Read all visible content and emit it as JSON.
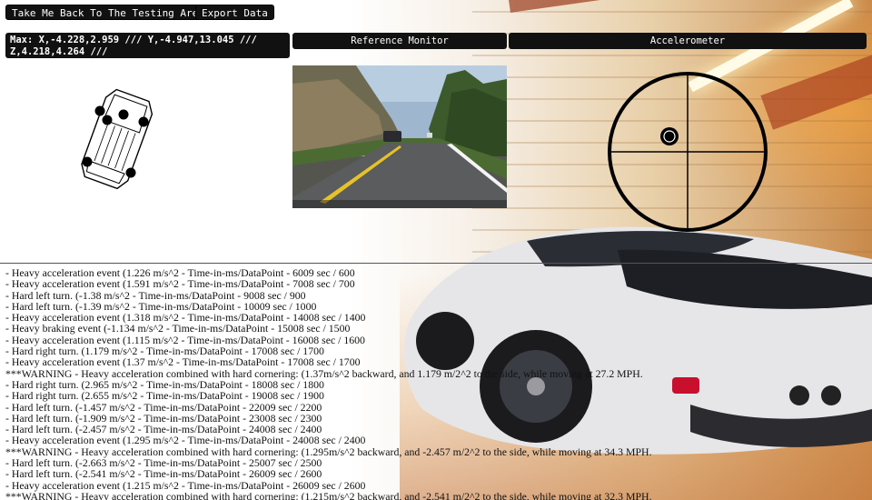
{
  "toolbar": {
    "back_label": "Take Me Back To The Testing Area",
    "export_label": "Export Data"
  },
  "max_readout": "Max: X,-4.228,2.959 /// Y,-4.947,13.045 /// Z,4.218,4.264 ///",
  "panels": {
    "reference_monitor": "Reference Monitor",
    "accelerometer": "Accelerometer"
  },
  "colors": {
    "panel_bg": "#111111",
    "panel_text": "#ffffff",
    "log_text": "#111111"
  },
  "log": [
    "- Heavy acceleration event (1.226 m/s^2 - Time-in-ms/DataPoint - 6009 sec / 600",
    "- Heavy acceleration event (1.591 m/s^2 - Time-in-ms/DataPoint - 7008 sec / 700",
    "- Hard left turn. (-1.38 m/s^2 - Time-in-ms/DataPoint - 9008 sec / 900",
    "- Hard left turn. (-1.39 m/s^2 - Time-in-ms/DataPoint - 10009 sec / 1000",
    "- Heavy acceleration event (1.318 m/s^2 - Time-in-ms/DataPoint - 14008 sec / 1400",
    "- Heavy braking event (-1.134 m/s^2 - Time-in-ms/DataPoint - 15008 sec / 1500",
    "- Heavy acceleration event (1.115 m/s^2 - Time-in-ms/DataPoint - 16008 sec / 1600",
    "- Hard right turn. (1.179 m/s^2 - Time-in-ms/DataPoint - 17008 sec / 1700",
    "- Heavy acceleration event (1.37 m/s^2 - Time-in-ms/DataPoint - 17008 sec / 1700",
    "***WARNING - Heavy acceleration combined with hard cornering: (1.37m/s^2 backward, and 1.179 m/2^2 to the side, while moving at 27.2 MPH.",
    "- Hard right turn. (2.965 m/s^2 - Time-in-ms/DataPoint - 18008 sec / 1800",
    "- Hard right turn. (2.655 m/s^2 - Time-in-ms/DataPoint - 19008 sec / 1900",
    "- Hard left turn. (-1.457 m/s^2 - Time-in-ms/DataPoint - 22009 sec / 2200",
    "- Hard left turn. (-1.909 m/s^2 - Time-in-ms/DataPoint - 23008 sec / 2300",
    "- Hard left turn. (-2.457 m/s^2 - Time-in-ms/DataPoint - 24008 sec / 2400",
    "- Heavy acceleration event (1.295 m/s^2 - Time-in-ms/DataPoint - 24008 sec / 2400",
    "***WARNING - Heavy acceleration combined with hard cornering: (1.295m/s^2 backward, and -2.457 m/2^2 to the side, while moving at 34.3 MPH.",
    "- Hard left turn. (-2.663 m/s^2 - Time-in-ms/DataPoint - 25007 sec / 2500",
    "- Hard left turn. (-2.541 m/s^2 - Time-in-ms/DataPoint - 26009 sec / 2600",
    "- Heavy acceleration event (1.215 m/s^2 - Time-in-ms/DataPoint - 26009 sec / 2600",
    "***WARNING - Heavy acceleration combined with hard cornering: (1.215m/s^2 backward, and -2.541 m/2^2 to the side, while moving at 32.3 MPH."
  ]
}
